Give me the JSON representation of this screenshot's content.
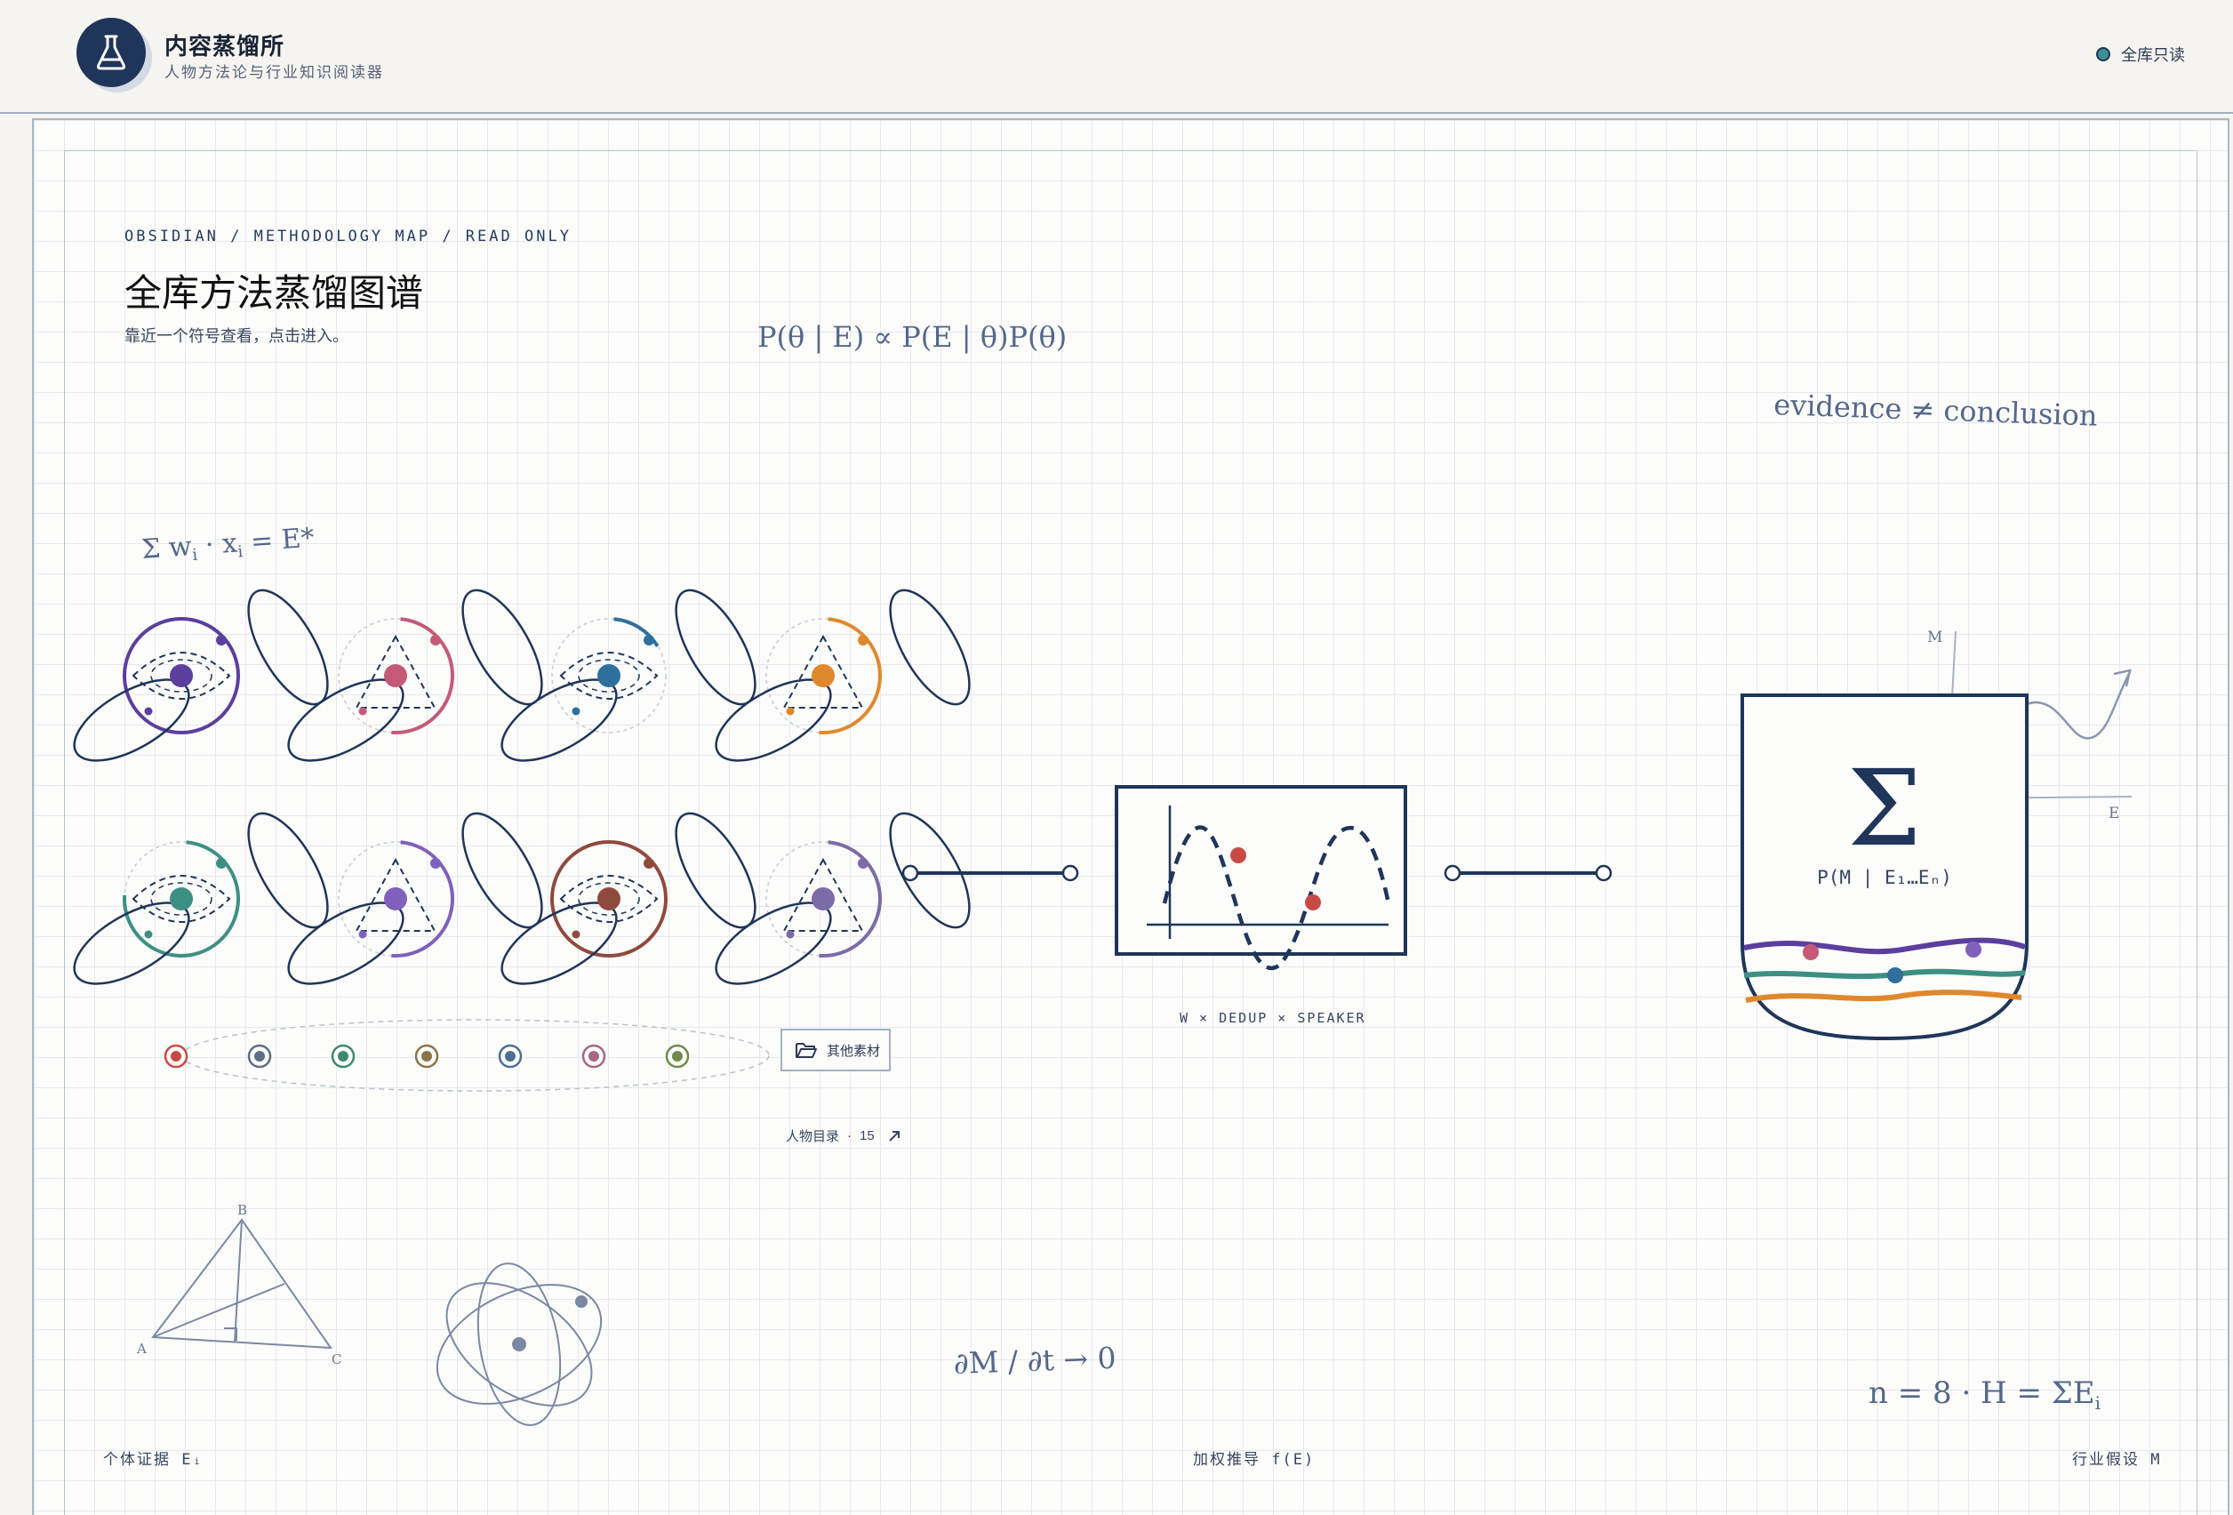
{
  "header": {
    "brand_title": "内容蒸馏所",
    "brand_subtitle": "人物方法论与行业知识阅读器",
    "readonly_label": "全库只读",
    "logo_icon": "flask-icon"
  },
  "page": {
    "breadcrumb": "OBSIDIAN / METHODOLOGY MAP / READ ONLY",
    "title": "全库方法蒸馏图谱",
    "hint": "靠近一个符号查看，点击进入。"
  },
  "formulas": {
    "bayes": "P(θ | E) ∝ P(E | θ)P(θ)",
    "evidence": "evidence ≠ conclusion",
    "weighted_sum_lhs": "Σ w",
    "weighted_sum_mid": " · x",
    "weighted_sum_rhs": " = E*",
    "sub_i": "i",
    "derivative": "∂M / ∂t → 0",
    "count_lhs": "n = 8 · H = ΣE",
    "count_sub": "i"
  },
  "persons": [
    {
      "color": "#5b3f9e",
      "style": "ring"
    },
    {
      "color": "#c45a78",
      "style": "triangle"
    },
    {
      "color": "#2f6f9e",
      "style": "eye"
    },
    {
      "color": "#e0882e",
      "style": "triangle"
    },
    {
      "color": "#3d8f84",
      "style": "ring-dashed"
    },
    {
      "color": "#7f60bd",
      "style": "triangle"
    },
    {
      "color": "#8f4a3e",
      "style": "ring"
    },
    {
      "color": "#7d6aa8",
      "style": "triangle"
    }
  ],
  "extra_persons": {
    "colors": [
      "#c94a44",
      "#5f6d86",
      "#3d8a70",
      "#8a7448",
      "#4d6f94",
      "#a86584",
      "#6f8a4a"
    ],
    "folder_label": "其他素材",
    "folder_icon": "folder-open-icon"
  },
  "directory_link": {
    "label": "人物目录",
    "count": "15",
    "arrow_icon": "arrow-up-right-icon"
  },
  "dedup_stage": {
    "label": "W × DEDUP × SPEAKER"
  },
  "aggregate": {
    "symbol": "Σ",
    "label": "P(M | E₁…Eₙ)",
    "axis_m": "M",
    "axis_e": "E",
    "strand_colors": [
      "#5b3f9e",
      "#3d8f84",
      "#e0882e"
    ]
  },
  "triangle_labels": [
    "A",
    "B",
    "C"
  ],
  "footer": {
    "left": "个体证据 Eᵢ",
    "center": "加权推导 f(E)",
    "right": "行业假设 M"
  }
}
